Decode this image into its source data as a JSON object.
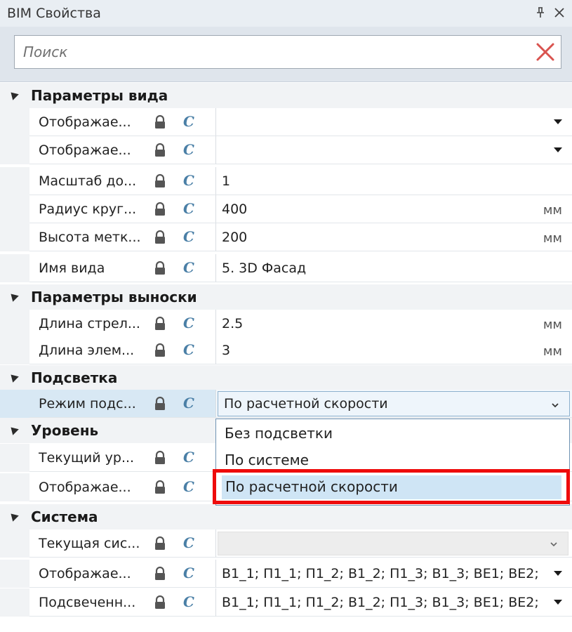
{
  "window": {
    "title": "BIM Свойства"
  },
  "search": {
    "placeholder": "Поиск"
  },
  "groups": [
    {
      "label": "Параметры вида",
      "rows": [
        {
          "name": "Отображае...",
          "value": "",
          "unit": ""
        },
        {
          "name": "Отображае...",
          "value": "",
          "unit": ""
        },
        {
          "name": "Масштаб до...",
          "value": "1",
          "unit": ""
        },
        {
          "name": "Радиус круг...",
          "value": "400",
          "unit": "мм"
        },
        {
          "name": "Высота метк...",
          "value": "200",
          "unit": "мм"
        },
        {
          "name": "Имя вида",
          "value": "5. 3D Фасад",
          "unit": ""
        }
      ]
    },
    {
      "label": "Параметры выноски",
      "rows": [
        {
          "name": "Длина стрел...",
          "value": "2.5",
          "unit": "мм"
        },
        {
          "name": "Длина элем...",
          "value": "3",
          "unit": "мм"
        }
      ]
    },
    {
      "label": "Подсветка",
      "rows": [
        {
          "name": "Режим подс...",
          "value": "По расчетной скорости",
          "unit": ""
        }
      ]
    },
    {
      "label": "Уровень",
      "rows": [
        {
          "name": "Текущий ур...",
          "value": "",
          "unit": ""
        },
        {
          "name": "Отображае...",
          "value": "",
          "unit": ""
        }
      ]
    },
    {
      "label": "Система",
      "rows": [
        {
          "name": "Текущая сис...",
          "value": "",
          "unit": ""
        },
        {
          "name": "Отображае...",
          "value": "В1_1; П1_1; П1_2; В1_2; П1_3; В1_3; ВЕ1; ВЕ2;",
          "unit": ""
        },
        {
          "name": "Подсвеченн...",
          "value": "В1_1; П1_1; П1_2; В1_2; П1_3; В1_3; ВЕ1; ВЕ2;",
          "unit": ""
        }
      ]
    }
  ],
  "dropdown": {
    "options": [
      "Без подсветки",
      "По системе",
      "По расчетной скорости"
    ],
    "highlighted_index": 2
  },
  "colors": {
    "accent": "#4a7fa6",
    "selection": "#cfe5f5",
    "highlight_frame": "#ee0b0b"
  },
  "icons": [
    "pin-icon",
    "close-icon",
    "clear-search-icon",
    "lock-icon",
    "c-icon",
    "dropdown-arrow-icon",
    "collapse-triangle-icon"
  ]
}
